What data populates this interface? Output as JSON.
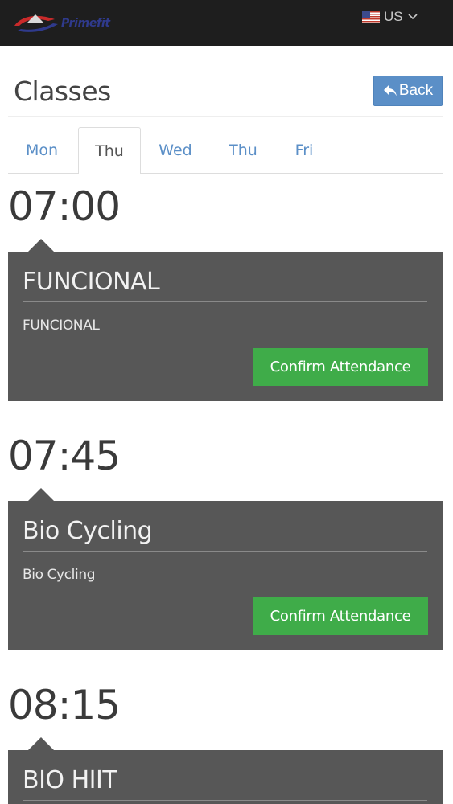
{
  "header": {
    "logo_text": "Primefit",
    "language": {
      "code": "US",
      "flag_icon": "us-flag-icon"
    }
  },
  "page": {
    "title": "Classes",
    "back_label": "Back"
  },
  "tabs": [
    {
      "label": "Mon",
      "active": false
    },
    {
      "label": "Thu",
      "active": true
    },
    {
      "label": "Wed",
      "active": false
    },
    {
      "label": "Thu",
      "active": false
    },
    {
      "label": "Fri",
      "active": false
    }
  ],
  "classes": [
    {
      "time": "07:00",
      "title": "FUNCIONAL",
      "description": "FUNCIONAL",
      "action_label": "Confirm Attendance"
    },
    {
      "time": "07:45",
      "title": "Bio Cycling",
      "description": "Bio Cycling",
      "action_label": "Confirm Attendance"
    },
    {
      "time": "08:15",
      "title": "BIO HIIT",
      "description": "",
      "action_label": ""
    }
  ],
  "colors": {
    "topbar": "#1e1e1e",
    "back_button": "#5b8fc7",
    "card": "#575757",
    "confirm_button": "#3fac49",
    "tab_link": "#5b8fc7"
  }
}
